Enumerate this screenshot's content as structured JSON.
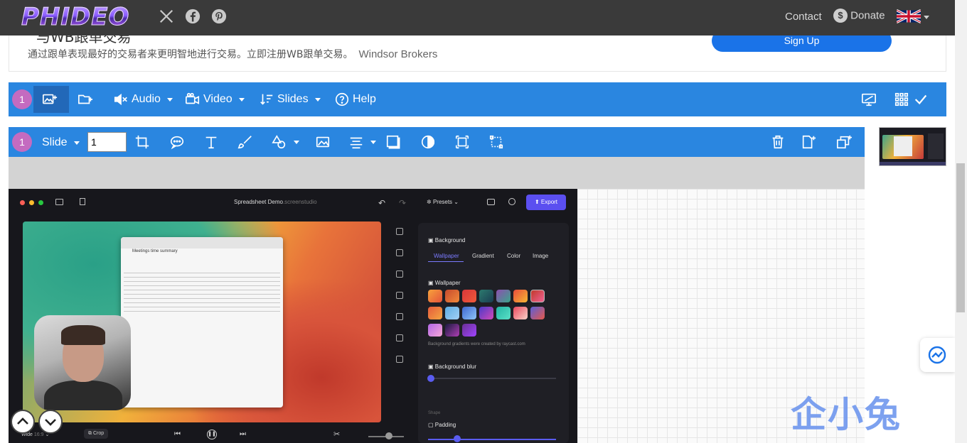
{
  "header": {
    "logo": "PHIDEO",
    "social": [
      "x-icon",
      "facebook-icon",
      "pinterest-icon"
    ],
    "contact": "Contact",
    "donate": "Donate",
    "language_flag": "uk-flag-icon"
  },
  "ad": {
    "headline_partial": "与WB跟单交易",
    "text": "通过跟单表现最好的交易者来更明智地进行交易。立即注册WB跟单交易。",
    "brand": "Windsor Brokers",
    "cta": "Sign Up"
  },
  "toolbar1": {
    "badge": "1",
    "audio": "Audio",
    "video": "Video",
    "slides": "Slides",
    "help": "Help"
  },
  "toolbar2": {
    "badge": "1",
    "slide_label": "Slide",
    "slide_number": "1"
  },
  "preview": {
    "app_title": "Spreadsheet Demo",
    "app_title_suffix": ".screenstudio",
    "presets": "Presets",
    "export": "Export",
    "sheet_title": "Meetings time summary",
    "panel": {
      "background": "Background",
      "tabs": [
        "Wallpaper",
        "Gradient",
        "Color",
        "Image"
      ],
      "wallpaper": "Wallpaper",
      "credit": "Background gradients were created by raycast.com",
      "blur": "Background blur",
      "shape": "Shape",
      "padding": "Padding"
    },
    "bottom": {
      "wide": "Wide",
      "ratio": "16:9",
      "crop": "Crop"
    }
  },
  "watermark": "企小兔",
  "colors": {
    "toolbar": "#2a86e0",
    "badge": "#c46bc0",
    "topbar": "#3a3a3a",
    "signup": "#1a73e8"
  }
}
